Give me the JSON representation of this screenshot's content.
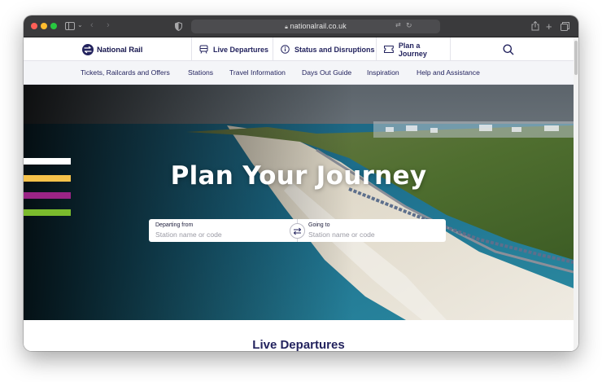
{
  "browser": {
    "url": "nationalrail.co.uk",
    "colors": {
      "close": "#ff5f57",
      "minimize": "#febc2e",
      "zoom": "#28c840"
    }
  },
  "site": {
    "logo_text": "National Rail",
    "brand_color": "#23235e"
  },
  "top_nav": {
    "items": [
      {
        "label": "Live Departures",
        "icon": "departures-board-icon"
      },
      {
        "label": "Status and Disruptions",
        "icon": "info-icon"
      },
      {
        "label": "Plan a Journey",
        "icon": "ticket-icon"
      }
    ],
    "search_icon": "search-icon"
  },
  "sub_nav": {
    "items": [
      "Tickets, Railcards and Offers",
      "Stations",
      "Travel Information",
      "Days Out Guide",
      "Inspiration",
      "Help and Assistance"
    ]
  },
  "hero": {
    "title": "Plan Your Journey",
    "stripe_colors": [
      "#ffffff",
      "#f6c24a",
      "#9b2486",
      "#7bbb2d"
    ],
    "from": {
      "label": "Departing from",
      "placeholder": "Station name or code"
    },
    "to": {
      "label": "Going to",
      "placeholder": "Station name or code"
    },
    "swap_icon": "swap-arrows-icon"
  },
  "section": {
    "heading": "Live Departures"
  }
}
